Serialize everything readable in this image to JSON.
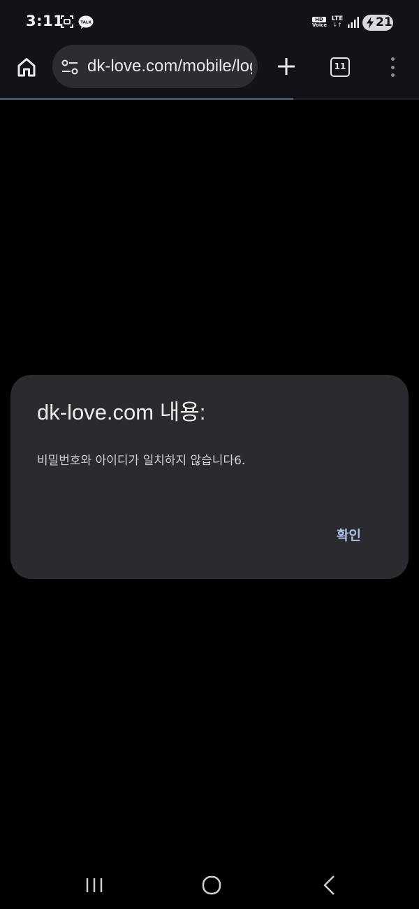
{
  "status_bar": {
    "time": "3:11",
    "notification_icons": [
      "screenshot-icon",
      "kakaotalk-icon"
    ],
    "talk_badge": "TALK",
    "hd_top": "HD",
    "hd_bottom": "Voice",
    "network": "LTE",
    "network_arrows": "↓↑",
    "battery_level": "21",
    "battery_charging": true
  },
  "browser": {
    "url": "dk-love.com/mobile/login",
    "tab_count": "11",
    "icons": {
      "home": "home-icon",
      "site_settings": "tune-icon",
      "new_tab": "plus-icon",
      "menu": "more-vert-icon"
    },
    "load_progress": 0.7
  },
  "dialog": {
    "title": "dk-love.com 내용:",
    "message": "비밀번호와 아이디가 일치하지 않습니다6.",
    "ok_label": "확인"
  },
  "navigation_bar": {
    "icons": [
      "recent-apps-icon",
      "home-circle-icon",
      "back-icon"
    ]
  },
  "colors": {
    "bar_background": "#111318",
    "url_bar": "#2b2d33",
    "dialog_background": "#2a2a2f",
    "dialog_accent": "#a9bfe9",
    "page_background": "#000000"
  }
}
